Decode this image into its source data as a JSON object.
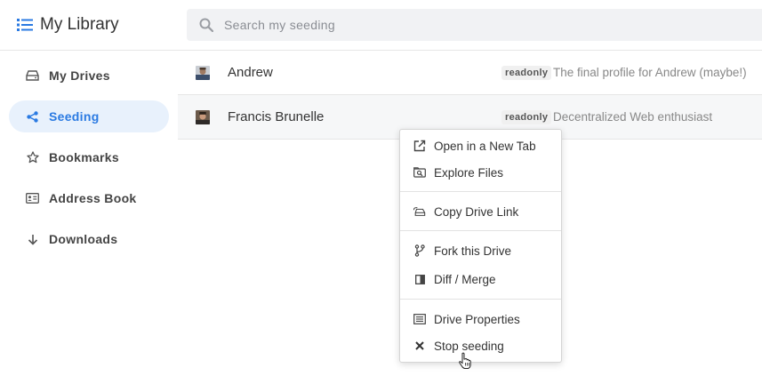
{
  "header": {
    "title": "My Library",
    "title_icon": "list-icon",
    "search": {
      "placeholder": "Search my seeding",
      "value": "",
      "icon": "search-icon"
    }
  },
  "sidebar": {
    "items": [
      {
        "label": "My Drives",
        "icon": "drive-icon",
        "active": false
      },
      {
        "label": "Seeding",
        "icon": "share-icon",
        "active": true
      },
      {
        "label": "Bookmarks",
        "icon": "star-icon",
        "active": false
      },
      {
        "label": "Address Book",
        "icon": "address-card-icon",
        "active": false
      },
      {
        "label": "Downloads",
        "icon": "arrow-down-icon",
        "active": false
      }
    ]
  },
  "rows": [
    {
      "name": "Andrew",
      "badge": "readonly",
      "description": "The final profile for Andrew (maybe!)"
    },
    {
      "name": "Francis Brunelle",
      "badge": "readonly",
      "description": "Decentralized Web enthusiast"
    }
  ],
  "context_menu": {
    "groups": [
      [
        {
          "label": "Open in a New Tab",
          "icon": "external-link-icon"
        },
        {
          "label": "Explore Files",
          "icon": "file-search-icon"
        }
      ],
      [
        {
          "label": "Copy Drive Link",
          "icon": "drive-link-icon"
        }
      ],
      [
        {
          "label": "Fork this Drive",
          "icon": "code-fork-icon"
        },
        {
          "label": "Diff / Merge",
          "icon": "diff-icon"
        }
      ],
      [
        {
          "label": "Drive Properties",
          "icon": "properties-list-icon"
        },
        {
          "label": "Stop seeding",
          "icon": "close-icon"
        }
      ]
    ]
  },
  "colors": {
    "accent": "#2a7ae2",
    "active_bg": "#e8f1fc",
    "search_bg": "#f1f2f4",
    "hover_row_bg": "#f6f7f8"
  }
}
